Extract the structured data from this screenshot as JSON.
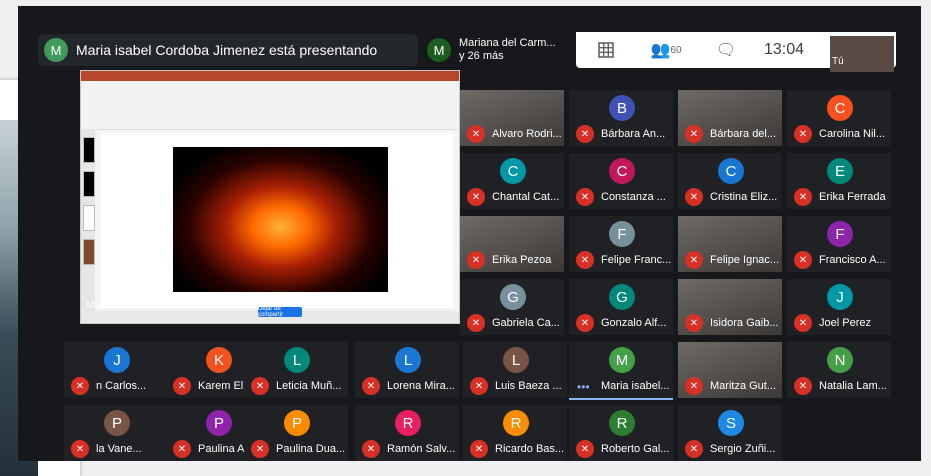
{
  "presenter": {
    "initial": "M",
    "text": "Maria isabel Cordoba Jimenez está presentando"
  },
  "others": {
    "initial": "M",
    "line1": "Mariana del Carm...",
    "line2": "y 26 más"
  },
  "controls": {
    "people_count": "60",
    "time": "13:04"
  },
  "self_label": "Tú",
  "slide": {
    "overlay_name": "Maria isabel Cordoba Jimenez",
    "share_button": "Dejar de compartir"
  },
  "participants": [
    {
      "initial": "",
      "name": "Alvaro Rodri...",
      "color": "#5f6368",
      "video": true
    },
    {
      "initial": "B",
      "name": "Bárbara An...",
      "color": "#3f51b5",
      "video": false
    },
    {
      "initial": "",
      "name": "Bárbara del...",
      "color": "#5f6368",
      "video": true
    },
    {
      "initial": "C",
      "name": "Carolina Nil...",
      "color": "#f4511e",
      "video": false
    },
    {
      "initial": "C",
      "name": "Chantal Cat...",
      "color": "#0097a7",
      "video": false
    },
    {
      "initial": "C",
      "name": "Constanza ...",
      "color": "#c2185b",
      "video": false
    },
    {
      "initial": "C",
      "name": "Cristina Eliz...",
      "color": "#1976d2",
      "video": false
    },
    {
      "initial": "E",
      "name": "Erika Ferrada",
      "color": "#00897b",
      "video": false
    },
    {
      "initial": "",
      "name": "Erika Pezoa",
      "color": "#5f6368",
      "video": true
    },
    {
      "initial": "F",
      "name": "Felipe Franc...",
      "color": "#78909c",
      "video": false
    },
    {
      "initial": "",
      "name": "Felipe Ignac...",
      "color": "#5f6368",
      "video": true
    },
    {
      "initial": "F",
      "name": "Francisco A...",
      "color": "#8e24aa",
      "video": false
    },
    {
      "initial": "G",
      "name": "Gabriela Ca...",
      "color": "#78909c",
      "video": false
    },
    {
      "initial": "G",
      "name": "Gonzalo Alf...",
      "color": "#00897b",
      "video": false
    },
    {
      "initial": "",
      "name": "Isidora Gaib...",
      "color": "#5f6368",
      "video": true
    },
    {
      "initial": "J",
      "name": "Joel Perez",
      "color": "#0097a7",
      "video": false
    },
    {
      "initial": "J",
      "name": "n Carlos...",
      "color": "#1976d2",
      "video": false
    },
    {
      "initial": "K",
      "name": "Karem Eliza...",
      "color": "#f4511e",
      "video": false
    },
    {
      "initial": "L",
      "name": "Leticia Muñ...",
      "color": "#00897b",
      "video": false
    },
    {
      "initial": "L",
      "name": "Lorena Mira...",
      "color": "#1976d2",
      "video": false
    },
    {
      "initial": "L",
      "name": "Luis Baeza ...",
      "color": "#795548",
      "video": false
    },
    {
      "initial": "M",
      "name": "Maria isabel...",
      "color": "#43a047",
      "video": false
    },
    {
      "initial": "",
      "name": "Maritza Gut...",
      "color": "#5f6368",
      "video": true
    },
    {
      "initial": "N",
      "name": "Natalia Lam...",
      "color": "#43a047",
      "video": false
    },
    {
      "initial": "P",
      "name": "la Vane...",
      "color": "#795548",
      "video": false
    },
    {
      "initial": "P",
      "name": "Paulina And...",
      "color": "#8e24aa",
      "video": false
    },
    {
      "initial": "P",
      "name": "Paulina Dua...",
      "color": "#fb8c00",
      "video": false
    },
    {
      "initial": "R",
      "name": "Ramón Salv...",
      "color": "#e91e63",
      "video": false
    },
    {
      "initial": "R",
      "name": "Ricardo Bas...",
      "color": "#fb8c00",
      "video": false
    },
    {
      "initial": "R",
      "name": "Roberto Gal...",
      "color": "#2e7d32",
      "video": false
    },
    {
      "initial": "S",
      "name": "Sergio Zuñi...",
      "color": "#1e88e5",
      "video": false
    }
  ]
}
